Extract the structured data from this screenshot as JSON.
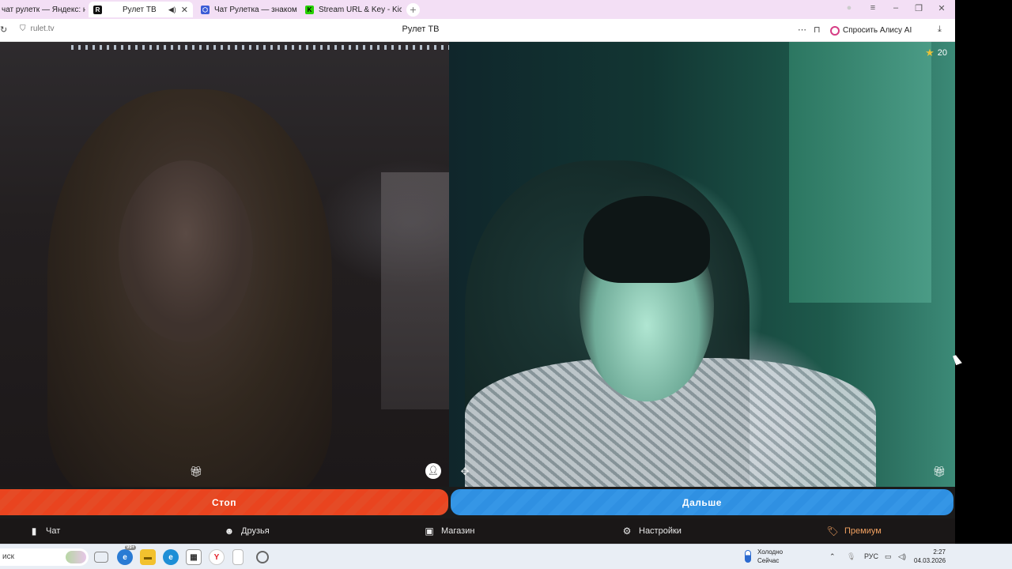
{
  "browser": {
    "tabs": [
      {
        "label": "чат рулетк — Яндекс: наш",
        "favicon_color": "#f3dff5",
        "active": false
      },
      {
        "label": "Рулет ТВ",
        "favicon_color": "#111111",
        "active": true,
        "audio": true
      },
      {
        "label": "Чат Рулетка — знакомств",
        "favicon_color": "#3b5bd6",
        "active": false
      },
      {
        "label": "Stream URL & Key - Kick D",
        "favicon_color": "#27d000",
        "active": false
      }
    ],
    "url": "rulet.tv",
    "page_title": "Рулет ТВ",
    "alice_label": "Спросить Алису AI"
  },
  "video": {
    "stars_count": "20"
  },
  "actions": {
    "stop_label": "Стоп",
    "next_label": "Дальше"
  },
  "nav": {
    "chat": "Чат",
    "friends": "Друзья",
    "shop": "Магазин",
    "settings": "Настройки",
    "premium": "Премиум"
  },
  "taskbar": {
    "search_text": "иск",
    "weather_title": "Холодно",
    "weather_sub": "Сейчас",
    "language": "РУС",
    "time": "2:27",
    "date": "04.03.2026",
    "notification_badge": "99+"
  },
  "colors": {
    "stop": "#e9441f",
    "next": "#2f90e2",
    "premium": "#f0a060",
    "tabstrip": "#f3dff5"
  }
}
